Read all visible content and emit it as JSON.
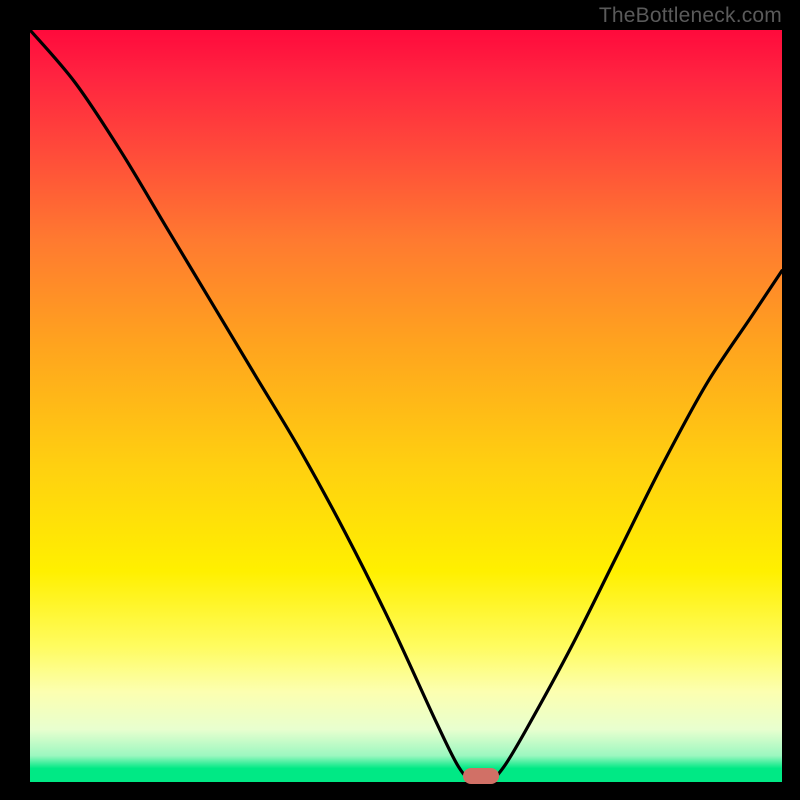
{
  "watermark": "TheBottleneck.com",
  "colors": {
    "frame": "#000000",
    "curve": "#000000",
    "marker": "#d17066",
    "gradient_top": "#ff0a3c",
    "gradient_bottom": "#00e985"
  },
  "chart_data": {
    "type": "line",
    "title": "",
    "xlabel": "",
    "ylabel": "",
    "xlim": [
      0,
      100
    ],
    "ylim": [
      0,
      100
    ],
    "x": [
      0,
      6,
      12,
      18,
      24,
      30,
      36,
      42,
      48,
      54,
      57,
      59,
      61,
      63,
      66,
      72,
      78,
      84,
      90,
      96,
      100
    ],
    "values": [
      100,
      93,
      84,
      74,
      64,
      54,
      44,
      33,
      21,
      8,
      2,
      0,
      0,
      2,
      7,
      18,
      30,
      42,
      53,
      62,
      68
    ],
    "marker": {
      "x": 60,
      "y": 0
    },
    "annotations": []
  }
}
